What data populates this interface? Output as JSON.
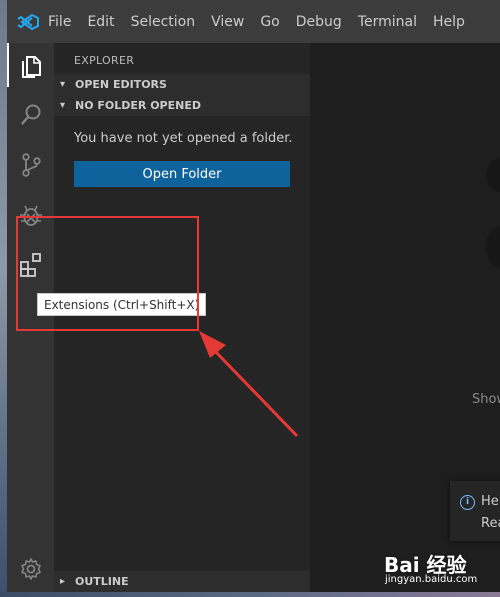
{
  "menu": {
    "items": [
      "File",
      "Edit",
      "Selection",
      "View",
      "Go",
      "Debug",
      "Terminal",
      "Help"
    ]
  },
  "sidebar": {
    "title": "EXPLORER",
    "sections": {
      "open_editors": "OPEN EDITORS",
      "no_folder": "NO FOLDER OPENED",
      "outline": "OUTLINE"
    },
    "message": "You have not yet opened a folder.",
    "open_folder_label": "Open Folder"
  },
  "tooltip": "Extensions (Ctrl+Shift+X)",
  "editor": {
    "partial_text": "Show"
  },
  "notification": {
    "line1": "Hel",
    "line2": "Rea"
  },
  "watermark": {
    "brand": "Bai 经验",
    "site": "jingyan.baidu.com"
  },
  "colors": {
    "accent": "#0e639c",
    "annotation": "#e53935",
    "vscode_blue": "#23a9f2"
  }
}
